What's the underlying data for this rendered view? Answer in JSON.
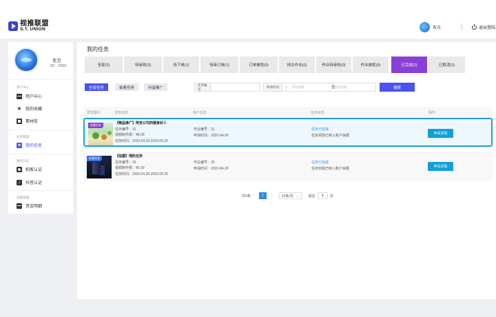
{
  "header": {
    "logo_cn": "视推联盟",
    "logo_en": "S.T. UNION",
    "user_name": "东方",
    "logout_label": "退出登陆"
  },
  "sidebar": {
    "profile_name": "东方",
    "profile_id": "ID：1059",
    "sections": [
      {
        "title": "用户中心",
        "items": [
          {
            "label": "用户中心",
            "icon": "home-icon"
          },
          {
            "label": "我的收藏",
            "icon": "star-icon"
          },
          {
            "label": "素材库",
            "icon": "book-icon"
          }
        ]
      },
      {
        "title": "任务管理",
        "items": [
          {
            "label": "我的任务",
            "icon": "task-icon",
            "active": true
          }
        ]
      },
      {
        "title": "我的认证",
        "items": [
          {
            "label": "拍客认证",
            "icon": "camera-icon"
          },
          {
            "label": "抖音认证",
            "icon": "tiktok-icon"
          }
        ]
      },
      {
        "title": "资金管理",
        "items": [
          {
            "label": "资金明细",
            "icon": "wallet-icon"
          }
        ]
      }
    ]
  },
  "main": {
    "title": "我的任务",
    "status_tabs": [
      {
        "label": "全部(2)"
      },
      {
        "label": "待审核(3)"
      },
      {
        "label": "待下单(1)"
      },
      {
        "label": "待审订单(1)"
      },
      {
        "label": "订单被拒(0)"
      },
      {
        "label": "待交作业(0)"
      },
      {
        "label": "作业待审核(0)"
      },
      {
        "label": "作业被拒(0)"
      },
      {
        "label": "已完成(2)",
        "active": true
      },
      {
        "label": "已取消(2)"
      }
    ],
    "type_buttons": [
      "全部任务",
      "拍客任务",
      "抖音推广"
    ],
    "filters": {
      "task_no_label": "任务编号",
      "task_no_placeholder": "",
      "apply_time_label": "申请时间",
      "start_placeholder": "开始日期",
      "date_separator": "至",
      "end_placeholder": "结束日期",
      "search_label": "搜索"
    },
    "table_headers": [
      "预览图片",
      "任务信息",
      "用户信息",
      "任务状态",
      "操作"
    ],
    "rows": [
      {
        "badge": "拍客任务",
        "title": "【精品推广】阿吉公司的健身好人",
        "task_no": "任务编号：31",
        "fee": "视频制作费：¥8.00",
        "task_time": "任务时间：2020.04.29-2020.05.29",
        "work_no": "作业编号：31",
        "apply_time": "申请时间：2020-04-30",
        "status": "任务已完成",
        "status_detail": "任务奖励已转入账户余额",
        "action_label": "申请详情"
      },
      {
        "badge": "拍客任务",
        "title": "【拍摄】喂奶任务",
        "task_no": "任务编号：26",
        "fee": "视频制作费：¥5.00",
        "task_time": "任务时间：2020.04.28-2020.05.28",
        "work_no": "作业编号：26",
        "apply_time": "申请时间：2020-04-29",
        "status": "任务已完成",
        "status_detail": "任务奖励已转入账户余额",
        "action_label": "申请详情"
      }
    ],
    "pagination": {
      "total": "共2条",
      "prev": "‹",
      "current": "1",
      "next": "›",
      "page_size": "10条/页",
      "goto_label": "前往",
      "goto_value": "1",
      "goto_suffix": "页"
    }
  },
  "colors": {
    "accent": "#4a52f0",
    "active_tab": "#8a40d8",
    "selected_border": "#1aa0e0",
    "action_button": "#10a0d8"
  }
}
